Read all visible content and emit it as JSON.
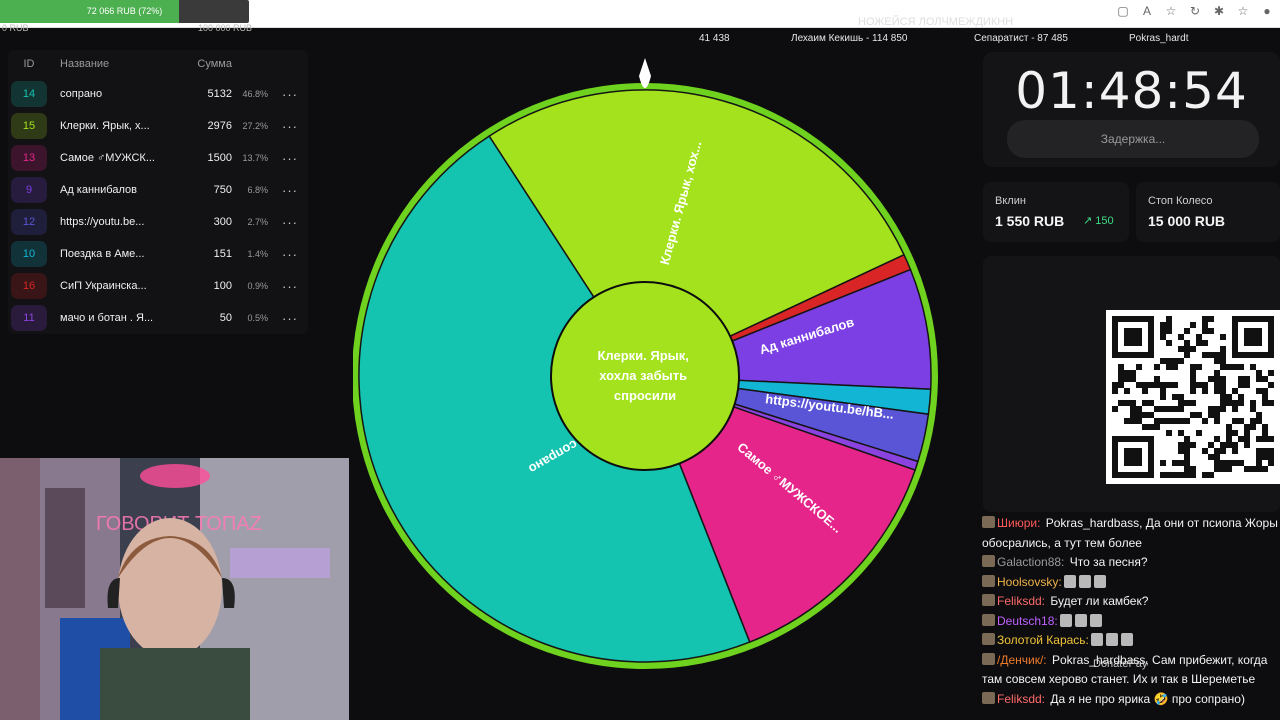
{
  "progress": {
    "text": "72 066 RUB (72%)",
    "fraction": 0.72,
    "left_label": "0 RUB",
    "right_label": "100 000 RUB"
  },
  "ghost_title": "НОЖЕЙСЯ ЛОЛЧМЕЖДИКНН",
  "stats": {
    "total": "41 438",
    "leader1": "Лехаим Кекишь - 114 850",
    "leader2": "Сепаратист - 87 485",
    "leader3": "Pokras_hardt"
  },
  "lots": {
    "headers": {
      "id": "ID",
      "name": "Название",
      "sum": "Сумма"
    },
    "menu_glyph": "···",
    "rows": [
      {
        "id": "14",
        "name": "сопрано",
        "sum": "5132",
        "pct": "46.8%",
        "color": "#14c3b0"
      },
      {
        "id": "15",
        "name": "Клерки. Ярык, х...",
        "sum": "2976",
        "pct": "27.2%",
        "color": "#a3e21c"
      },
      {
        "id": "13",
        "name": "Самое ♂МУЖСК...",
        "sum": "1500",
        "pct": "13.7%",
        "color": "#e5258a"
      },
      {
        "id": "9",
        "name": "Ад  каннибалов",
        "sum": "750",
        "pct": "6.8%",
        "color": "#7b3fe4"
      },
      {
        "id": "12",
        "name": "https://youtu.be...",
        "sum": "300",
        "pct": "2.7%",
        "color": "#5a55d6"
      },
      {
        "id": "10",
        "name": "Поездка в Аме...",
        "sum": "151",
        "pct": "1.4%",
        "color": "#12b5d3"
      },
      {
        "id": "16",
        "name": "СиП Украинска...",
        "sum": "100",
        "pct": "0.9%",
        "color": "#d92525"
      },
      {
        "id": "11",
        "name": "мачо и ботан . Я...",
        "sum": "50",
        "pct": "0.5%",
        "color": "#8b43e0"
      }
    ]
  },
  "wheel": {
    "center_text": [
      "Клерки. Ярык,",
      "хохла забыть",
      "спросили"
    ],
    "labels": {
      "soprano": "сопрано",
      "klerki": "Клерки. Ярык, хох...",
      "ad": "Ад  каннибалов",
      "youtube": "https://youtu.be/hB...",
      "samoe": "Самое ♂МУЖСКОЕ..."
    }
  },
  "timer": {
    "value": "01:48:54",
    "delay_label": "Задержка..."
  },
  "cards": {
    "vklin": {
      "label": "Вклин",
      "value": "1 550 RUB",
      "delta": "↗ 150"
    },
    "stop": {
      "label": "Стоп Колесо",
      "value": "15 000 RUB"
    }
  },
  "chat": [
    {
      "nick": "Шиюри:",
      "color": "#ff5a5a",
      "text": " Pokras_hardbass, Да они от псиопа Жоры обосрались, а тут тем более"
    },
    {
      "nick": "Galaction88:",
      "color": "#9a9a9a",
      "text": " Что за песня?"
    },
    {
      "nick": "Hoolsovsky:",
      "color": "#f0b24a",
      "text": ""
    },
    {
      "nick": "Feliksdd:",
      "color": "#ff6b6b",
      "text": " Будет ли камбек?"
    },
    {
      "nick": "Deutsch18:",
      "color": "#c061ff",
      "text": ""
    },
    {
      "nick": "Золотой Карась:",
      "color": "#f0c43a",
      "text": ""
    },
    {
      "nick": "/Денчик/:",
      "color": "#f07b2b",
      "text": " Pokras_hardbass, Сам прибежит, когда там совсем херово станет. Их и так в Шереметье"
    },
    {
      "nick": "Feliksdd:",
      "color": "#ff6b6b",
      "text": " Да я не про ярика 🤣 про сопрано)"
    }
  ],
  "donate_label": "DonatePay",
  "webcam_sign": "ГОВОРИТ ТОПАZ"
}
